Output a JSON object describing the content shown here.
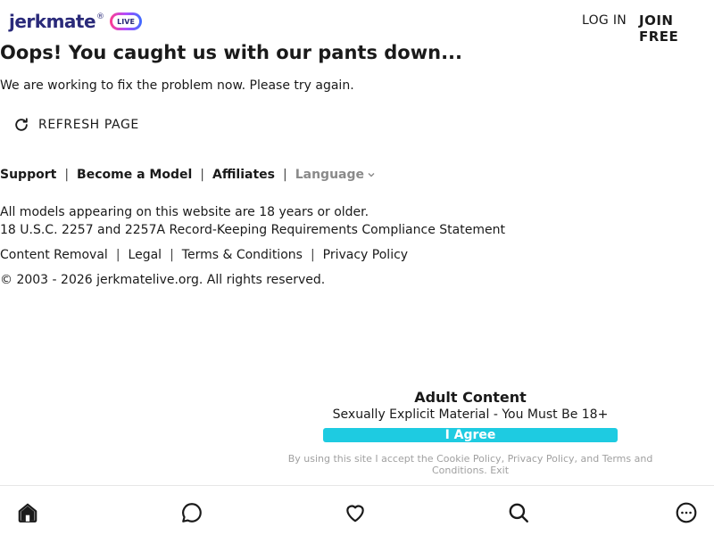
{
  "header": {
    "logo_text": "jerkmate",
    "logo_mark": "®",
    "logo_badge": "LIVE",
    "login_label": "LOG IN",
    "join_label": "JOIN FREE"
  },
  "main": {
    "title": "Oops! You caught us with our pants down...",
    "subtitle": "We are working to fix the problem now. Please try again.",
    "refresh_label": "REFRESH PAGE",
    "refresh_icon": "refresh-icon"
  },
  "footer": {
    "links": {
      "support": "Support",
      "become_model": "Become a Model",
      "affiliates": "Affiliates",
      "language": "Language",
      "separator": "|"
    },
    "notice_age": "All models appearing on this website are 18 years or older.",
    "notice_2257": "18 U.S.C. 2257 and 2257A Record-Keeping Requirements Compliance Statement",
    "legal": {
      "content_removal": "Content Removal",
      "legal": "Legal",
      "terms": "Terms & Conditions",
      "privacy": "Privacy Policy"
    },
    "copyright": "© 2003 - 2026 jerkmatelive.org. All rights reserved."
  },
  "age_gate": {
    "title": "Adult Content",
    "subtitle": "Sexually Explicit Material - You Must Be 18+",
    "agree_label": "I Agree",
    "fine_prefix": "By using this site I accept the ",
    "cookie_policy": "Cookie Policy",
    "comma": ", ",
    "privacy_policy": "Privacy Policy",
    "and": ", and ",
    "terms": "Terms and Conditions",
    "period": ". ",
    "exit": "Exit",
    "button_color": "#1ecbe1"
  },
  "bottom_nav": {
    "icons": [
      "home-icon",
      "chat-icon",
      "heart-icon",
      "search-icon",
      "more-icon"
    ]
  }
}
